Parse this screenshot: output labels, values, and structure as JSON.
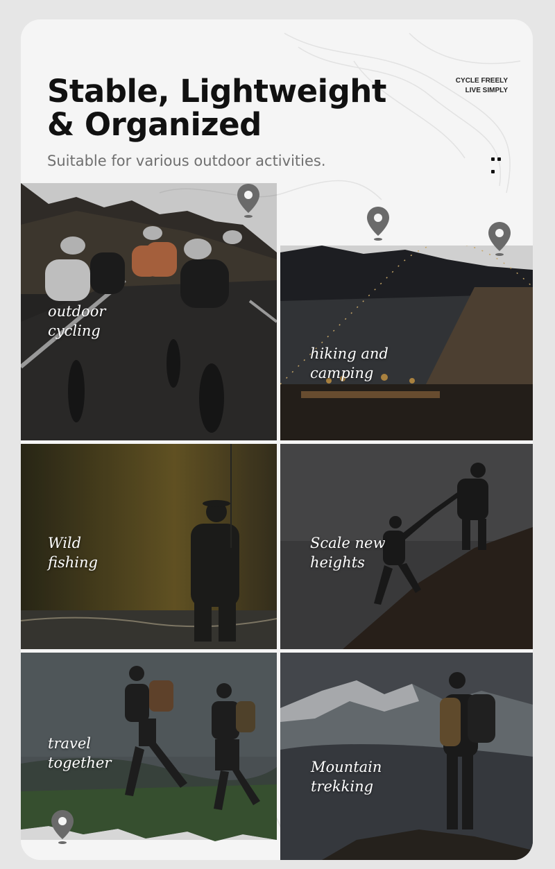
{
  "header": {
    "title": "Stable, Lightweight & Organized",
    "subtitle": "Suitable for various outdoor activities.",
    "slogan_line1": "CYCLE FREELY",
    "slogan_line2": "LIVE SIMPLY"
  },
  "activities": [
    {
      "label": "outdoor\ncycling"
    },
    {
      "label": "hiking  and\ncamping"
    },
    {
      "label": "Wild\nfishing"
    },
    {
      "label": "Scale  new\nheights"
    },
    {
      "label": "travel\ntogether"
    },
    {
      "label": "Mountain\ntrekking"
    }
  ],
  "colors": {
    "background": "#f5f5f5",
    "title": "#111111",
    "subtitle": "#6f6f6f",
    "pin": "#6a6a6a",
    "caption": "#ffffff"
  }
}
